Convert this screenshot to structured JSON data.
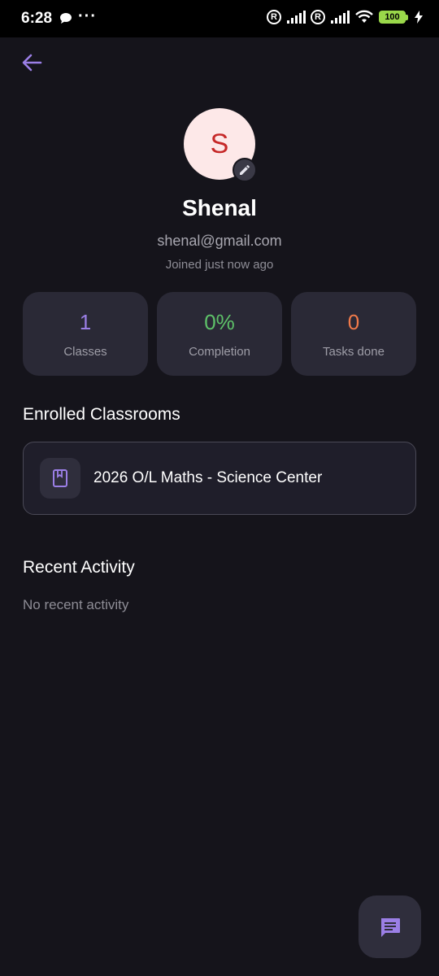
{
  "status_bar": {
    "time": "6:28",
    "dots": "···",
    "reg_mark": "R",
    "battery_level": "100"
  },
  "profile": {
    "avatar_initial": "S",
    "name": "Shenal",
    "email": "shenal@gmail.com",
    "joined": "Joined just now ago"
  },
  "stats": [
    {
      "value": "1",
      "label": "Classes",
      "color": "#9b7fe6"
    },
    {
      "value": "0%",
      "label": "Completion",
      "color": "#5ec269"
    },
    {
      "value": "0",
      "label": "Tasks done",
      "color": "#f07a4a"
    }
  ],
  "enrolled": {
    "title": "Enrolled Classrooms",
    "classrooms": [
      {
        "name": "2026 O/L Maths - Science Center",
        "icon": "book-icon"
      }
    ]
  },
  "activity": {
    "title": "Recent Activity",
    "empty_text": "No recent activity"
  },
  "colors": {
    "background": "#15141b",
    "accent": "#9b7fe6",
    "card": "#2a2936"
  },
  "icons": {
    "back": "arrow-left-icon",
    "edit": "pencil-icon",
    "fab": "chat-icon"
  }
}
